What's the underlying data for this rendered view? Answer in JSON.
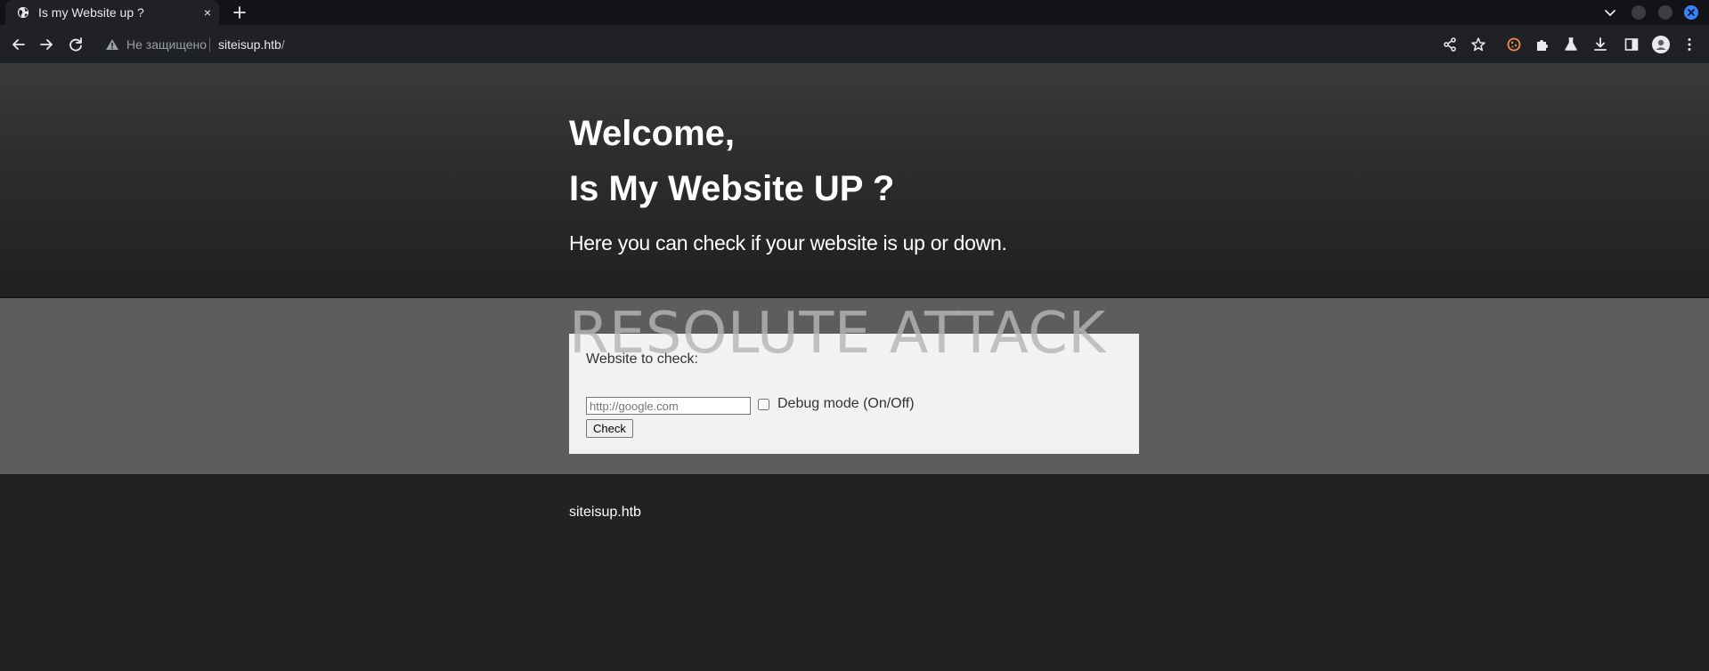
{
  "browser": {
    "tab": {
      "title": "Is my Website up ?",
      "close_glyph": "×"
    },
    "new_tab_icon": "plus-icon",
    "address_bar": {
      "security_label": "Не защищено",
      "url_host": "siteisup.htb",
      "url_path": "/"
    },
    "toolbar_icons": [
      "share-icon",
      "bookmark-star-icon",
      "cookie-extension-icon",
      "extensions-puzzle-icon",
      "labs-flask-icon",
      "download-icon",
      "side-panel-icon",
      "profile-avatar-icon",
      "menu-kebab-icon"
    ],
    "colors": {
      "chrome_bg": "#202124",
      "tabstrip_bg": "#121317",
      "close_button": "#3b82f6"
    }
  },
  "hero": {
    "welcome": "Welcome,",
    "title": "Is My Website UP ?",
    "subtitle": "Here you can check if your website is up or down."
  },
  "watermark": "RESOLUTE ATTACK",
  "form": {
    "label": "Website to check:",
    "input_value": "",
    "input_placeholder": "http://google.com",
    "debug_checked": false,
    "debug_label": "Debug mode (On/Off)",
    "submit_label": "Check"
  },
  "footer": {
    "text": "siteisup.htb"
  },
  "colors": {
    "band_bg": "#5e5d5d",
    "card_bg": "#f2f2f2",
    "footer_bg": "#222222"
  }
}
